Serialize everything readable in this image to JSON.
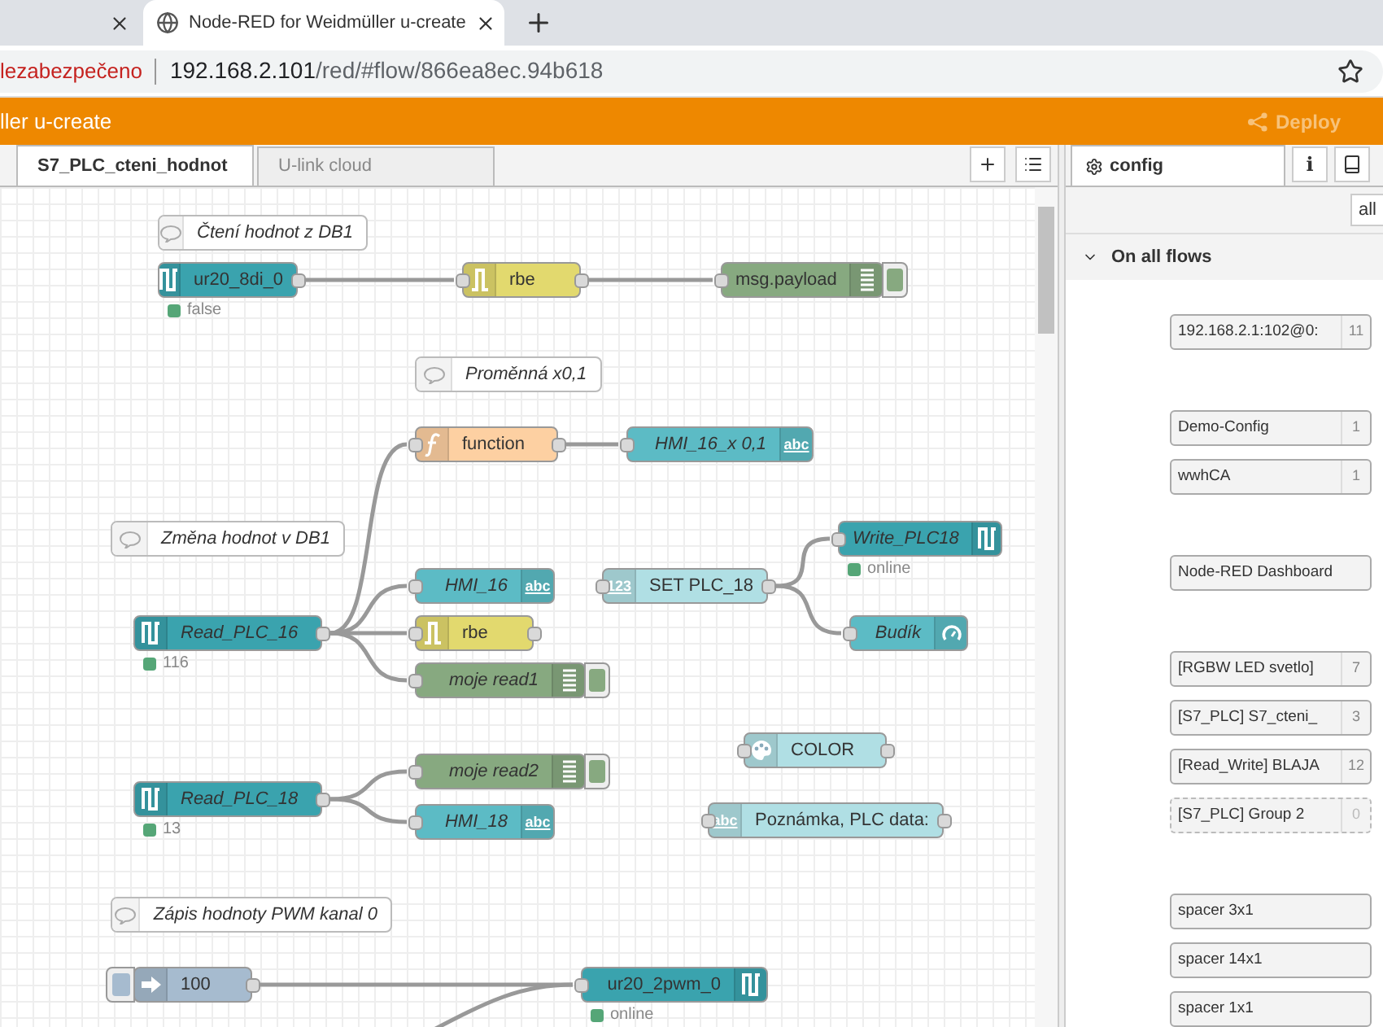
{
  "browser": {
    "tabs": [
      {
        "selected": false
      },
      {
        "title": "Node-RED for Weidmüller u-create",
        "selected": true
      }
    ],
    "address": {
      "warning": "lezabezpečeno",
      "host": "192.168.2.101",
      "path": "/red/#flow/866ea8ec.94b618"
    }
  },
  "header": {
    "title": "ller u-create",
    "deploy": "Deploy"
  },
  "workspace_tabs": [
    {
      "label": "S7_PLC_cteni_hodnot",
      "selected": true
    },
    {
      "label": "U-link cloud",
      "selected": false
    }
  ],
  "canvas": {
    "nodes": [
      {
        "kind": "comment",
        "label": "Čtení hodnot z DB1"
      },
      {
        "kind": "node",
        "label": "ur20_8di_0",
        "status": {
          "text": "false",
          "color": "#55a677"
        }
      },
      {
        "kind": "node",
        "label": "rbe"
      },
      {
        "kind": "node",
        "label": "msg.payload"
      },
      {
        "kind": "comment",
        "label": "Proměnná x0,1"
      },
      {
        "kind": "node",
        "label": "function"
      },
      {
        "kind": "node",
        "label": "HMI_16_x 0,1",
        "icon_text": "abc"
      },
      {
        "kind": "comment",
        "label": "Změna hodnot v DB1"
      },
      {
        "kind": "node",
        "label": "Write_PLC18",
        "status": {
          "text": "online",
          "color": "#55a677"
        }
      },
      {
        "kind": "node",
        "label": "HMI_16",
        "icon_text": "abc"
      },
      {
        "kind": "node",
        "label": "SET PLC_18",
        "icon_text": "123"
      },
      {
        "kind": "node",
        "label": "Read_PLC_16",
        "status": {
          "text": "116",
          "color": "#55a677"
        }
      },
      {
        "kind": "node",
        "label": "rbe"
      },
      {
        "kind": "node",
        "label": "Budík"
      },
      {
        "kind": "node",
        "label": "moje read1"
      },
      {
        "kind": "node",
        "label": "COLOR"
      },
      {
        "kind": "node",
        "label": "moje read2"
      },
      {
        "kind": "node",
        "label": "Read_PLC_18",
        "status": {
          "text": "13",
          "color": "#55a677"
        }
      },
      {
        "kind": "node",
        "label": "HMI_18",
        "icon_text": "abc"
      },
      {
        "kind": "node",
        "label": "Poznámka, PLC data:",
        "icon_text": "abc"
      },
      {
        "kind": "comment",
        "label": "Zápis hodnoty PWM kanal 0"
      },
      {
        "kind": "node",
        "label": "100"
      },
      {
        "kind": "node",
        "label": "ur20_2pwm_0",
        "status": {
          "text": "online",
          "color": "#55a677"
        }
      }
    ]
  },
  "sidebar": {
    "tab": "config",
    "info_button": "i",
    "filter_button": "all",
    "section": "On all flows",
    "groups": [
      [
        {
          "label": "192.168.2.1:102@0:",
          "count": "11",
          "unused": false
        }
      ],
      [
        {
          "label": "Demo-Config",
          "count": "1",
          "unused": false
        },
        {
          "label": "wwhCA",
          "count": "1",
          "unused": false
        }
      ],
      [
        {
          "label": "Node-RED Dashboard",
          "unused": false
        }
      ],
      [
        {
          "label": "[RGBW LED svetlo]",
          "count": "7",
          "unused": false
        },
        {
          "label": "[S7_PLC] S7_cteni_",
          "count": "3",
          "unused": false
        },
        {
          "label": "[Read_Write] BLAJA",
          "count": "12",
          "unused": false
        },
        {
          "label": "[S7_PLC] Group 2",
          "count": "0",
          "unused": true
        }
      ],
      [
        {
          "label": "spacer 3x1",
          "unused": false
        },
        {
          "label": "spacer 14x1",
          "unused": false
        },
        {
          "label": "spacer 1x1",
          "unused": false
        }
      ]
    ]
  }
}
